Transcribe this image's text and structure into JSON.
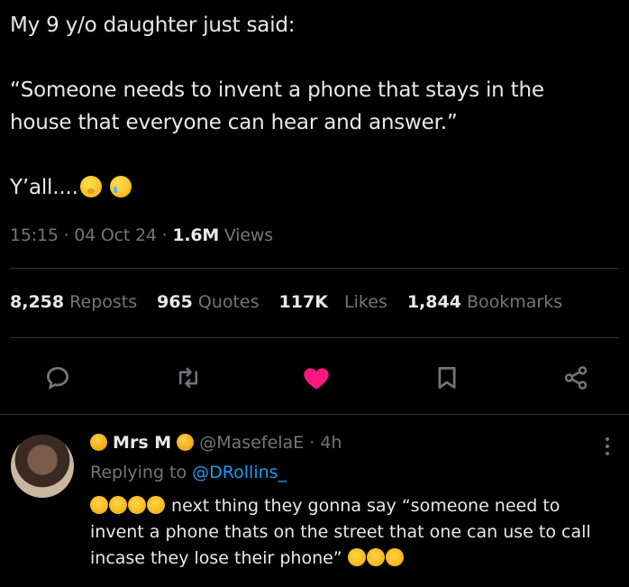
{
  "tweet": {
    "line1": "My 9 y/o daughter just said:",
    "line2": "“Someone needs to invent a phone that stays in the",
    "line3": "house that everyone can hear and answer.”",
    "line4": "Y’all....",
    "emojis": [
      "hushed-face-icon",
      "smiling-face-with-tear-icon"
    ]
  },
  "meta": {
    "time": "15:15",
    "date": "04 Oct 24",
    "views_count": "1.6M",
    "views_label": "Views",
    "separator": "·"
  },
  "stats": [
    {
      "num": "8,258",
      "label": "Reposts"
    },
    {
      "num": "965",
      "label": "Quotes"
    },
    {
      "num": "117K",
      "label": "Likes"
    },
    {
      "num": "1,844",
      "label": "Bookmarks"
    }
  ],
  "actions": {
    "reply": "reply-icon",
    "repost": "repost-icon",
    "like": "heart-icon",
    "bookmark": "bookmark-icon",
    "share": "share-icon",
    "like_color": "#f91880",
    "icon_color": "#71767b"
  },
  "reply": {
    "name": "Mrs M",
    "handle": "@MasefelaE",
    "age": "4h",
    "replying_prefix": "Replying to",
    "replying_to": "@DRollins_",
    "body_line1": "next thing they gonna say “someone need to",
    "body_line2": "invent a phone thats on the street that one can use to call",
    "body_line3": "incase they lose their phone”"
  },
  "colors": {
    "background": "#000000",
    "text": "#e7e9ea",
    "muted": "#71767b",
    "link": "#1d9bf0",
    "divider": "#2f3336"
  }
}
